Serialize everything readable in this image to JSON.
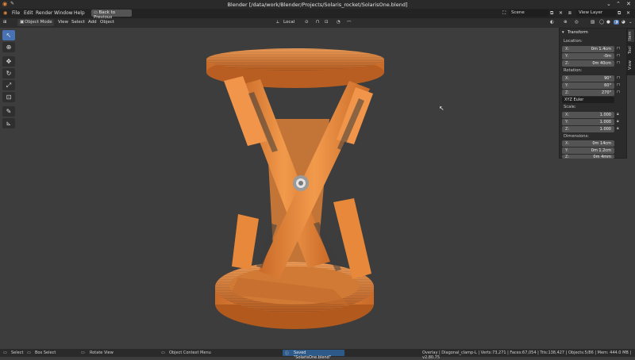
{
  "window": {
    "title": "Blender [/data/work/Blender/Projects/Solaris_rocket/SolarisOne.blend]"
  },
  "menu": {
    "items": [
      "File",
      "Edit",
      "Render",
      "Window",
      "Help"
    ],
    "back_button": "Back to Previous",
    "scene_label": "Scene",
    "view_layer_label": "View Layer"
  },
  "header": {
    "mode": "Object Mode",
    "items": [
      "View",
      "Select",
      "Add",
      "Object"
    ],
    "pivot": "Local"
  },
  "npanel": {
    "section": "Transform",
    "location_label": "Location:",
    "location": [
      {
        "axis": "X:",
        "value": "0m 1.4cm"
      },
      {
        "axis": "Y:",
        "value": "-0m"
      },
      {
        "axis": "Z:",
        "value": "0m 40cm"
      }
    ],
    "rotation_label": "Rotation:",
    "rotation": [
      {
        "axis": "X:",
        "value": "90°"
      },
      {
        "axis": "Y:",
        "value": "60°"
      },
      {
        "axis": "Z:",
        "value": "270°"
      }
    ],
    "euler": "XYZ Euler",
    "scale_label": "Scale:",
    "scale": [
      {
        "axis": "X:",
        "value": "1.000"
      },
      {
        "axis": "Y:",
        "value": "1.000"
      },
      {
        "axis": "Z:",
        "value": "1.000"
      }
    ],
    "dimensions_label": "Dimensions:",
    "dimensions": [
      {
        "axis": "X:",
        "value": "0m 14cm"
      },
      {
        "axis": "Y:",
        "value": "0m 1.2cm"
      },
      {
        "axis": "Z:",
        "value": "0m 4mm"
      }
    ],
    "tabs": [
      "Item",
      "Tool",
      "View"
    ]
  },
  "status": {
    "select": "Select",
    "box_select": "Box Select",
    "rotate_view": "Rotate View",
    "context_menu": "Object Context Menu",
    "saved": "Saved \"SolarisOne.blend\"",
    "stats": "Overlay | Diagonal_clamp-L | Verts:73,271 | Faces:67,054 | Tris:138,427 | Objects:5/86 | Mem: 444.0 MB | v2.80.75"
  },
  "colors": {
    "accent": "#4772b3",
    "model": "#e8883a",
    "background": "#3d3d3d"
  }
}
